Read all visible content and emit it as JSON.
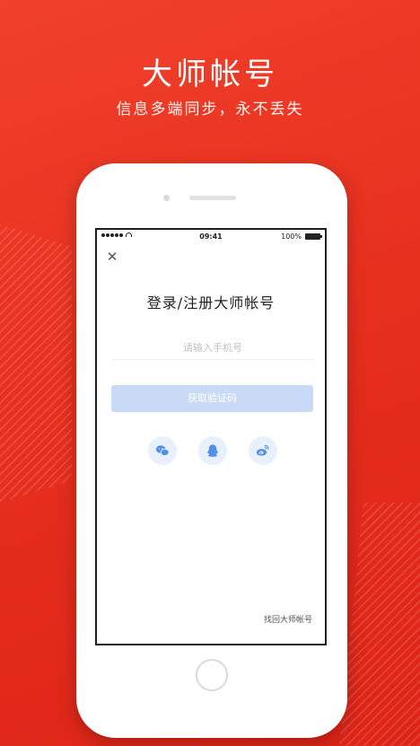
{
  "promo": {
    "headline": "大师帐号",
    "subline": "信息多端同步，永不丢失"
  },
  "status_bar": {
    "time": "09:41",
    "battery": "100%"
  },
  "login": {
    "title": "登录/注册大师帐号",
    "phone_placeholder": "请输入手机号",
    "phone_value": "",
    "get_code_label": "获取验证码",
    "recover_link": "找回大师帐号",
    "social_icons": [
      "wechat-icon",
      "qq-icon",
      "weibo-icon"
    ]
  },
  "colors": {
    "background": "#e8301f",
    "button_disabled": "#c9daf6",
    "social_bg": "#e8f0fb",
    "social_icon": "#4f8fe6"
  }
}
